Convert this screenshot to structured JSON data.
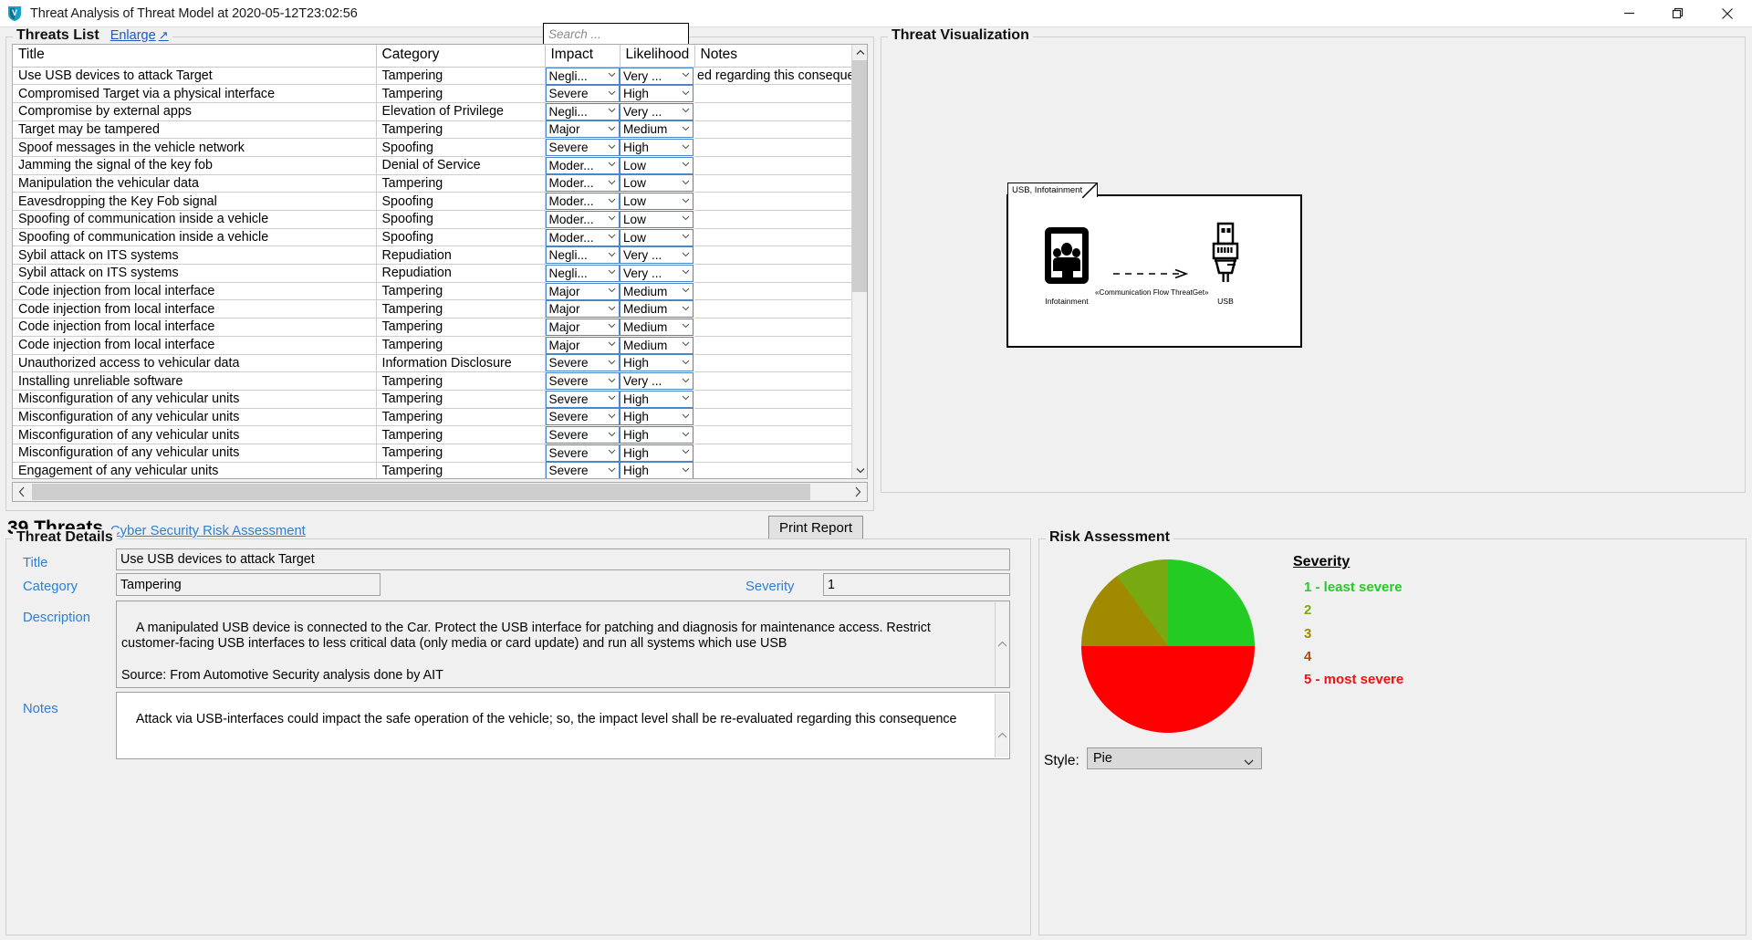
{
  "window": {
    "title": "Threat Analysis of Threat Model at 2020-05-12T23:02:56",
    "app_icon": "threatget-logo-icon",
    "minimize_label": "Minimize",
    "restore_label": "Restore",
    "close_label": "Close"
  },
  "threats_list": {
    "legend": "Threats List",
    "enlarge_label": "Enlarge",
    "search_placeholder": "Search ...",
    "search_value": "",
    "columns": [
      "Title",
      "Category",
      "Impact",
      "Likelihood",
      "Notes"
    ],
    "rows": [
      {
        "title": "Use USB devices to attack Target",
        "category": "Tampering",
        "impact": "Negli...",
        "likelihood": "Very ...",
        "notes": "ed regarding this conseque"
      },
      {
        "title": "Compromised  Target via a physical interface",
        "category": "Tampering",
        "impact": "Severe",
        "likelihood": "High",
        "notes": ""
      },
      {
        "title": "Compromise by external apps",
        "category": "Elevation of Privilege",
        "impact": "Negli...",
        "likelihood": "Very ...",
        "notes": ""
      },
      {
        "title": "Target may be tampered",
        "category": "Tampering",
        "impact": "Major",
        "likelihood": "Medium",
        "notes": ""
      },
      {
        "title": "Spoof messages in the vehicle network",
        "category": "Spoofing",
        "impact": "Severe",
        "likelihood": "High",
        "notes": ""
      },
      {
        "title": "Jamming the signal of the key fob",
        "category": "Denial of Service",
        "impact": "Moder...",
        "likelihood": "Low",
        "notes": ""
      },
      {
        "title": "Manipulation the vehicular data",
        "category": "Tampering",
        "impact": "Moder...",
        "likelihood": "Low",
        "notes": ""
      },
      {
        "title": "Eavesdropping the Key Fob signal",
        "category": "Spoofing",
        "impact": "Moder...",
        "likelihood": "Low",
        "notes": ""
      },
      {
        "title": "Spoofing of communication inside a vehicle",
        "category": "Spoofing",
        "impact": "Moder...",
        "likelihood": "Low",
        "notes": ""
      },
      {
        "title": "Spoofing of communication inside a vehicle",
        "category": "Spoofing",
        "impact": "Moder...",
        "likelihood": "Low",
        "notes": ""
      },
      {
        "title": "Sybil attack on ITS systems",
        "category": "Repudiation",
        "impact": "Negli...",
        "likelihood": "Very ...",
        "notes": ""
      },
      {
        "title": "Sybil attack on ITS systems",
        "category": "Repudiation",
        "impact": "Negli...",
        "likelihood": "Very ...",
        "notes": ""
      },
      {
        "title": "Code injection from local interface",
        "category": "Tampering",
        "impact": "Major",
        "likelihood": "Medium",
        "notes": ""
      },
      {
        "title": "Code injection from local interface",
        "category": "Tampering",
        "impact": "Major",
        "likelihood": "Medium",
        "notes": ""
      },
      {
        "title": "Code injection from local interface",
        "category": "Tampering",
        "impact": "Major",
        "likelihood": "Medium",
        "notes": ""
      },
      {
        "title": "Code injection from local interface",
        "category": "Tampering",
        "impact": "Major",
        "likelihood": "Medium",
        "notes": ""
      },
      {
        "title": "Unauthorized access to vehicular data",
        "category": "Information Disclosure",
        "impact": "Severe",
        "likelihood": "High",
        "notes": ""
      },
      {
        "title": "Installing unreliable software",
        "category": "Tampering",
        "impact": "Severe",
        "likelihood": "Very ...",
        "notes": ""
      },
      {
        "title": "Misconfiguration of any vehicular units",
        "category": "Tampering",
        "impact": "Severe",
        "likelihood": "High",
        "notes": ""
      },
      {
        "title": "Misconfiguration of any vehicular units",
        "category": "Tampering",
        "impact": "Severe",
        "likelihood": "High",
        "notes": ""
      },
      {
        "title": "Misconfiguration of any vehicular units",
        "category": "Tampering",
        "impact": "Severe",
        "likelihood": "High",
        "notes": ""
      },
      {
        "title": "Misconfiguration of any vehicular units",
        "category": "Tampering",
        "impact": "Severe",
        "likelihood": "High",
        "notes": ""
      },
      {
        "title": "Engagement of any vehicular units",
        "category": "Tampering",
        "impact": "Severe",
        "likelihood": "High",
        "notes": ""
      }
    ]
  },
  "status": {
    "count_label": "39 Threats",
    "risk_link": "Cyber Security Risk Assessment",
    "print_label": "Print Report"
  },
  "visualization": {
    "legend": "Threat Visualization",
    "diagram_tab": "USB, Infotainment",
    "node_left": "Infotainment",
    "node_right": "USB",
    "flow_label": "«Communication Flow ThreatGet»"
  },
  "details": {
    "legend": "Threat Details",
    "title_label": "Title",
    "title_value": "Use USB devices to attack Target",
    "category_label": "Category",
    "category_value": "Tampering",
    "severity_label": "Severity",
    "severity_value": "1",
    "description_label": "Description",
    "description_value": "A manipulated USB device is connected to the Car. Protect the USB interface for patching and diagnosis for maintenance access. Restrict customer-facing USB interfaces to less critical data (only media or card update) and run all systems which use USB\n\nSource: From Automotive Security analysis done by AIT",
    "notes_label": "Notes",
    "notes_value": "Attack via USB-interfaces could impact the safe operation of the vehicle; so, the impact level shall be re-evaluated regarding this consequence"
  },
  "risk": {
    "legend": "Risk Assessment",
    "severity_title": "Severity",
    "style_label": "Style:",
    "style_value": "Pie",
    "legend_items": [
      {
        "text": "1 - least severe",
        "color": "#22cc22"
      },
      {
        "text": "2",
        "color": "#77aa11"
      },
      {
        "text": "3",
        "color": "#a08a00"
      },
      {
        "text": "4",
        "color": "#b04a12"
      },
      {
        "text": "5 - most severe",
        "color": "#ee1111"
      }
    ]
  },
  "chart_data": {
    "type": "pie",
    "title": "Risk Assessment",
    "categories": [
      "1 - least severe",
      "2",
      "3",
      "4",
      "5 - most severe"
    ],
    "values": [
      25,
      10,
      15,
      0,
      50
    ],
    "colors": [
      "#22cc22",
      "#77aa11",
      "#a08a00",
      "#b04a12",
      "#ff0000"
    ],
    "legend_position": "right",
    "units": "percent"
  }
}
